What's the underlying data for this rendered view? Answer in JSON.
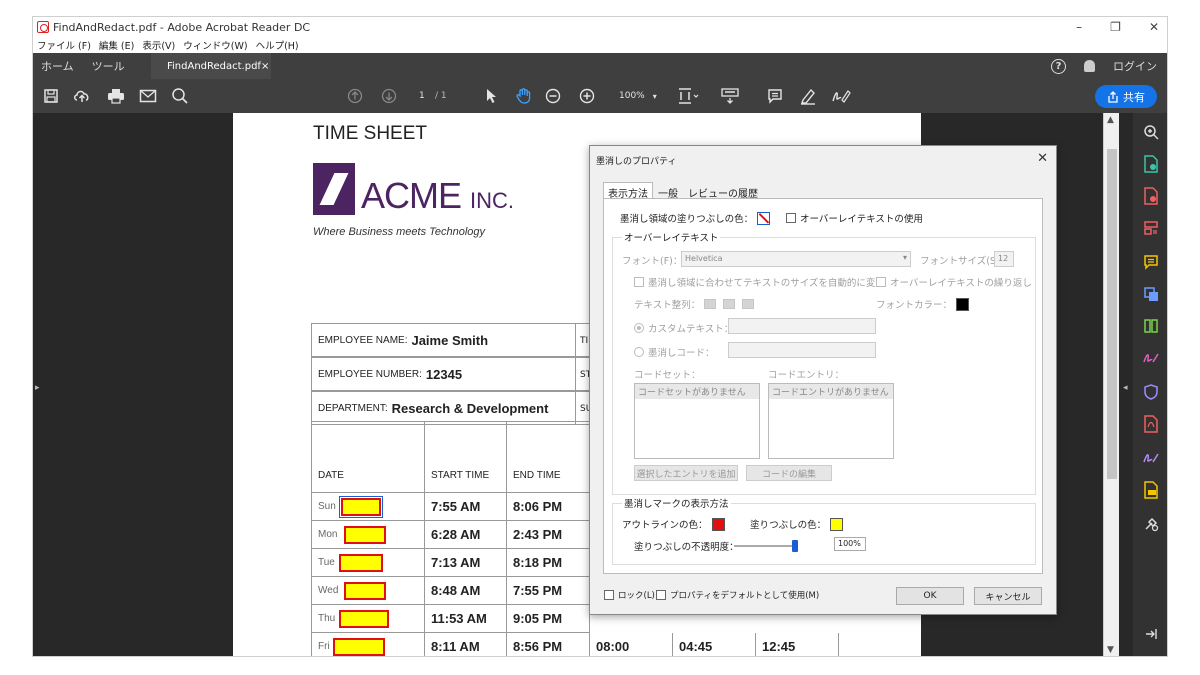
{
  "window": {
    "title": "FindAndRedact.pdf - Adobe Acrobat Reader DC",
    "controls": [
      "–",
      "❐",
      "✕"
    ]
  },
  "menu": [
    "ファイル (F)",
    "編集 (E)",
    "表示(V)",
    "ウィンドウ(W)",
    "ヘルプ(H)"
  ],
  "tabbar": {
    "home": "ホーム",
    "tools": "ツール",
    "doc_tab": "FindAndRedact.pdf",
    "doc_tab_close": "×",
    "login": "ログイン",
    "help": "?"
  },
  "toolbar": {
    "page_current": "1",
    "page_total": "/ 1",
    "zoom": "100%",
    "share": "共有"
  },
  "document": {
    "title": "TIME SHEET",
    "logo_name": "ACME",
    "logo_suffix": "INC.",
    "tagline": "Where Business meets Technology",
    "employee_name_label": "EMPLOYEE NAME:",
    "employee_name": "Jaime Smith",
    "employee_number_label": "EMPLOYEE NUMBER:",
    "employee_number": "12345",
    "department_label": "DEPARTMENT:",
    "department": "Research & Development",
    "side_cells": [
      "TI",
      "ST",
      "SU"
    ],
    "headers": [
      "DATE",
      "START TIME",
      "END TIME"
    ],
    "rows": [
      {
        "day": "Sun",
        "start": "7:55 AM",
        "end": "8:06 PM"
      },
      {
        "day": "Mon",
        "start": "6:28 AM",
        "end": "2:43 PM"
      },
      {
        "day": "Tue",
        "start": "7:13 AM",
        "end": "8:18 PM"
      },
      {
        "day": "Wed",
        "start": "8:48 AM",
        "end": "7:55 PM"
      },
      {
        "day": "Thu",
        "start": "11:53 AM",
        "end": "9:05 PM"
      },
      {
        "day": "Fri",
        "start": "8:11 AM",
        "end": "8:56 PM",
        "c4": "08:00",
        "c5": "04:45",
        "c6": "12:45"
      }
    ]
  },
  "dialog": {
    "title": "墨消しのプロパティ",
    "close": "✕",
    "tabs": [
      "表示方法",
      "一般",
      "レビューの履歴"
    ],
    "fill_color_label": "墨消し領域の塗りつぶしの色：",
    "use_overlay_label": "オーバーレイテキストの使用",
    "overlay_section": "オーバーレイテキスト",
    "font_label": "フォント(F)：",
    "font_value": "Helvetica",
    "font_size_label": "フォントサイズ(S)：",
    "font_size_value": "12",
    "auto_size_label": "墨消し領域に合わせてテキストのサイズを自動的に変更",
    "repeat_label": "オーバーレイテキストの繰り返し",
    "align_label": "テキスト整列：",
    "font_color_label": "フォントカラー：",
    "custom_text_label": "カスタムテキスト：",
    "redact_code_label": "墨消しコード：",
    "code_set_label": "コードセット：",
    "code_entry_label": "コードエントリ：",
    "code_set_empty": "コードセットがありません",
    "code_entry_empty": "コードエントリがありません",
    "add_selected": "選択したエントリを追加",
    "edit_code": "コードの編集",
    "mark_section": "墨消しマークの表示方法",
    "outline_color_label": "アウトラインの色：",
    "mark_fill_label": "塗りつぶしの色：",
    "opacity_label": "塗りつぶしの不透明度：",
    "opacity_value": "100%",
    "lock_label": "ロック(L)",
    "default_label": "プロパティをデフォルトとして使用(M)",
    "ok": "OK",
    "cancel": "キャンセル"
  },
  "colors": {
    "outline": "#e01010",
    "fill": "#ffff00",
    "share": "#1473e6",
    "brand": "#4b2461"
  }
}
